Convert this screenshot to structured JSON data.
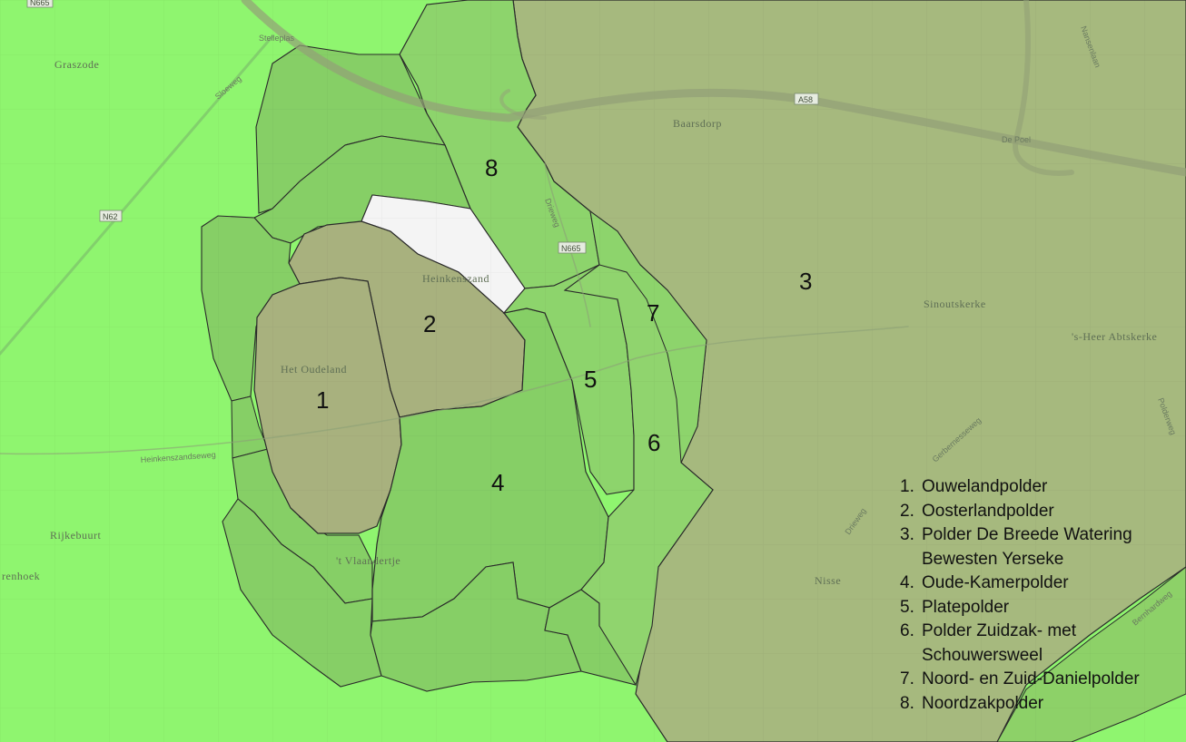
{
  "map": {
    "colors": {
      "background": "#8ff56f",
      "polder_green": "#86d469",
      "polder_olive": "#a6b97e",
      "polder_tan": "#a3af7e",
      "town": "#f4f4f4",
      "boundary": "#2a2a2a"
    },
    "polders": [
      {
        "number": "1",
        "name": "Ouwelandpolder"
      },
      {
        "number": "2",
        "name": "Oosterlandpolder"
      },
      {
        "number": "3",
        "name": "Polder De Breede Watering\nBewesten Yerseke"
      },
      {
        "number": "4",
        "name": "Oude-Kamerpolder"
      },
      {
        "number": "5",
        "name": "Platepolder"
      },
      {
        "number": "6",
        "name": "Polder Zuidzak- met\nSchouwersweel"
      },
      {
        "number": "7",
        "name": "Noord- en Zuid-Danielpolder"
      },
      {
        "number": "8",
        "name": "Noordzakpolder"
      }
    ],
    "places": {
      "graszode": "Graszode",
      "baarsdorp": "Baarsdorp",
      "heinkenszand": "Heinkenszand",
      "het_oudeland": "Het Oudeland",
      "sinoutskerke": "Sinoutskerke",
      "heer_abtskerke": "'s-Heer Abtskerke",
      "rijkebuurt": "Rijkebuurt",
      "vlaandertje": "'t Vlaandertje",
      "nisse": "Nisse",
      "renhoek": "renhoek"
    },
    "roads": {
      "a58": "A58",
      "n62": "N62",
      "n665_top": "N665",
      "n665": "N665",
      "sloeweg": "Sloeweg",
      "stelleplas": "Stelleplas",
      "de_poel": "De Poel",
      "heinkenszandseweg": "Heinkenszandseweg",
      "gerbernesseweg": "Gerbernesseweg",
      "driewegweg": "Drieweg",
      "driewegweg_south": "Drieweg",
      "poldersweg": "Polderweg",
      "bernhardweg": "Bernhardweg",
      "nansenlaan": "Nansenlaan"
    }
  }
}
